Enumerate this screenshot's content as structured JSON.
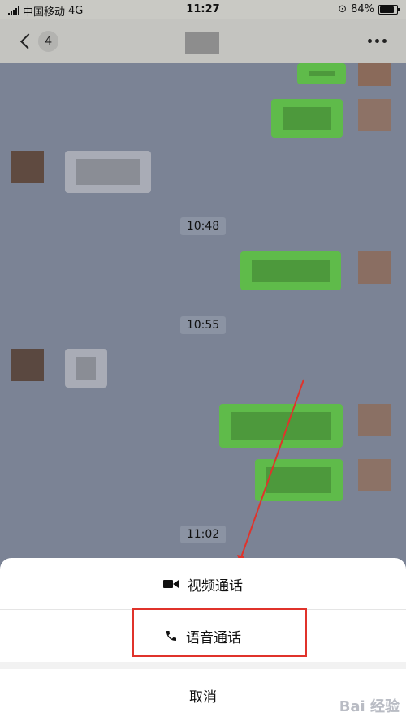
{
  "status_bar": {
    "carrier": "中国移动",
    "network": "4G",
    "time": "11:27",
    "battery": "84%",
    "battery_level": 0.84
  },
  "nav": {
    "back_badge": "4"
  },
  "chat": {
    "timestamps": [
      "10:48",
      "10:55",
      "11:02"
    ]
  },
  "sheet": {
    "video_call": "视频通话",
    "voice_call": "语音通话",
    "cancel": "取消"
  },
  "watermark": "Bai 经验",
  "colors": {
    "sent_bubble": "#5fbb4a",
    "highlight_box": "#e0332b",
    "chat_bg": "#7b8395"
  }
}
